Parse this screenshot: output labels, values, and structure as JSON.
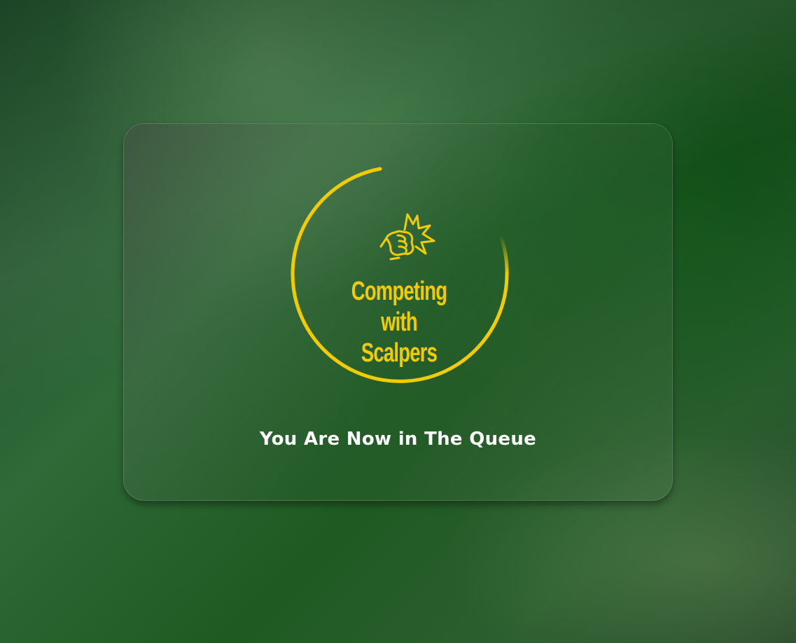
{
  "logo": {
    "line1": "Competing with",
    "line2": "Scalpers",
    "icon": "fist-punch-icon",
    "color": "#f2cc00"
  },
  "status": {
    "message": "You Are Now in The Queue"
  },
  "colors": {
    "background_dark": "#1c4426",
    "background_mid": "#2f6a38",
    "accent": "#f2cc00",
    "text": "#ffffff"
  }
}
